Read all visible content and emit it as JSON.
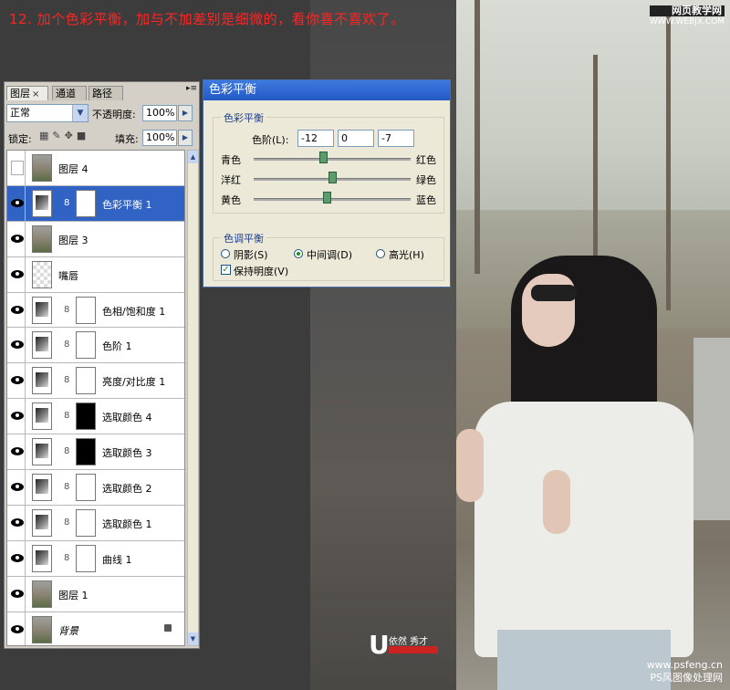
{
  "caption": "12. 加个色彩平衡，加与不加差别是细微的，看你喜不喜欢了。",
  "watermark_top": {
    "line1": "网页教学网",
    "line2": "WWW.WEBJX.COM"
  },
  "watermark_bottom": {
    "line1": "www.psfeng.cn",
    "line2": "PS风图像处理网"
  },
  "signature": {
    "letter": "U",
    "text": "依然 秀才"
  },
  "layers_panel": {
    "tabs": [
      {
        "label": "图层",
        "close": "×"
      },
      {
        "label": "通道"
      },
      {
        "label": "路径"
      }
    ],
    "menu_icon": "▸≡",
    "blend_mode": "正常",
    "opacity_label": "不透明度:",
    "opacity_value": "100%",
    "lock_label": "锁定:",
    "fill_label": "填充:",
    "fill_value": "100%",
    "layers": [
      {
        "name": "图层 4",
        "visible": false,
        "type": "photo",
        "selected": false
      },
      {
        "name": "色彩平衡 1",
        "visible": true,
        "type": "adj",
        "mask": "white",
        "selected": true,
        "icon": "color-balance-icon"
      },
      {
        "name": "图层 3",
        "visible": true,
        "type": "photo",
        "selected": false
      },
      {
        "name": "嘴唇",
        "visible": true,
        "type": "checker",
        "selected": false
      },
      {
        "name": "色相/饱和度 1",
        "visible": true,
        "type": "adj",
        "mask": "white",
        "selected": false,
        "icon": "hue-saturation-icon"
      },
      {
        "name": "色阶 1",
        "visible": true,
        "type": "adj",
        "mask": "white",
        "selected": false,
        "icon": "levels-icon"
      },
      {
        "name": "亮度/对比度 1",
        "visible": true,
        "type": "adj",
        "mask": "white",
        "selected": false,
        "icon": "brightness-contrast-icon"
      },
      {
        "name": "选取颜色 4",
        "visible": true,
        "type": "adj",
        "mask": "black",
        "selected": false,
        "icon": "selective-color-icon"
      },
      {
        "name": "选取颜色 3",
        "visible": true,
        "type": "adj",
        "mask": "black",
        "selected": false,
        "icon": "selective-color-icon"
      },
      {
        "name": "选取颜色 2",
        "visible": true,
        "type": "adj",
        "mask": "white",
        "selected": false,
        "icon": "selective-color-icon"
      },
      {
        "name": "选取颜色 1",
        "visible": true,
        "type": "adj",
        "mask": "white",
        "selected": false,
        "icon": "selective-color-icon"
      },
      {
        "name": "曲线 1",
        "visible": true,
        "type": "adj",
        "mask": "white",
        "selected": false,
        "icon": "curves-icon"
      },
      {
        "name": "图层 1",
        "visible": true,
        "type": "photo",
        "selected": false
      },
      {
        "name": "背景",
        "visible": true,
        "type": "photo",
        "selected": false,
        "locked": true
      }
    ]
  },
  "color_balance": {
    "title": "色彩平衡",
    "group1_title": "色彩平衡",
    "levels_label": "色阶(L):",
    "levels": [
      "-12",
      "0",
      "-7"
    ],
    "sliders": [
      {
        "left": "青色",
        "right": "红色",
        "value": -12
      },
      {
        "left": "洋红",
        "right": "绿色",
        "value": 0
      },
      {
        "left": "黄色",
        "right": "蓝色",
        "value": -7
      }
    ],
    "group2_title": "色调平衡",
    "tones": [
      {
        "label": "阴影(S)",
        "checked": false
      },
      {
        "label": "中间调(D)",
        "checked": true
      },
      {
        "label": "高光(H)",
        "checked": false
      }
    ],
    "preserve_label": "保持明度(V)",
    "preserve_checked": true
  }
}
